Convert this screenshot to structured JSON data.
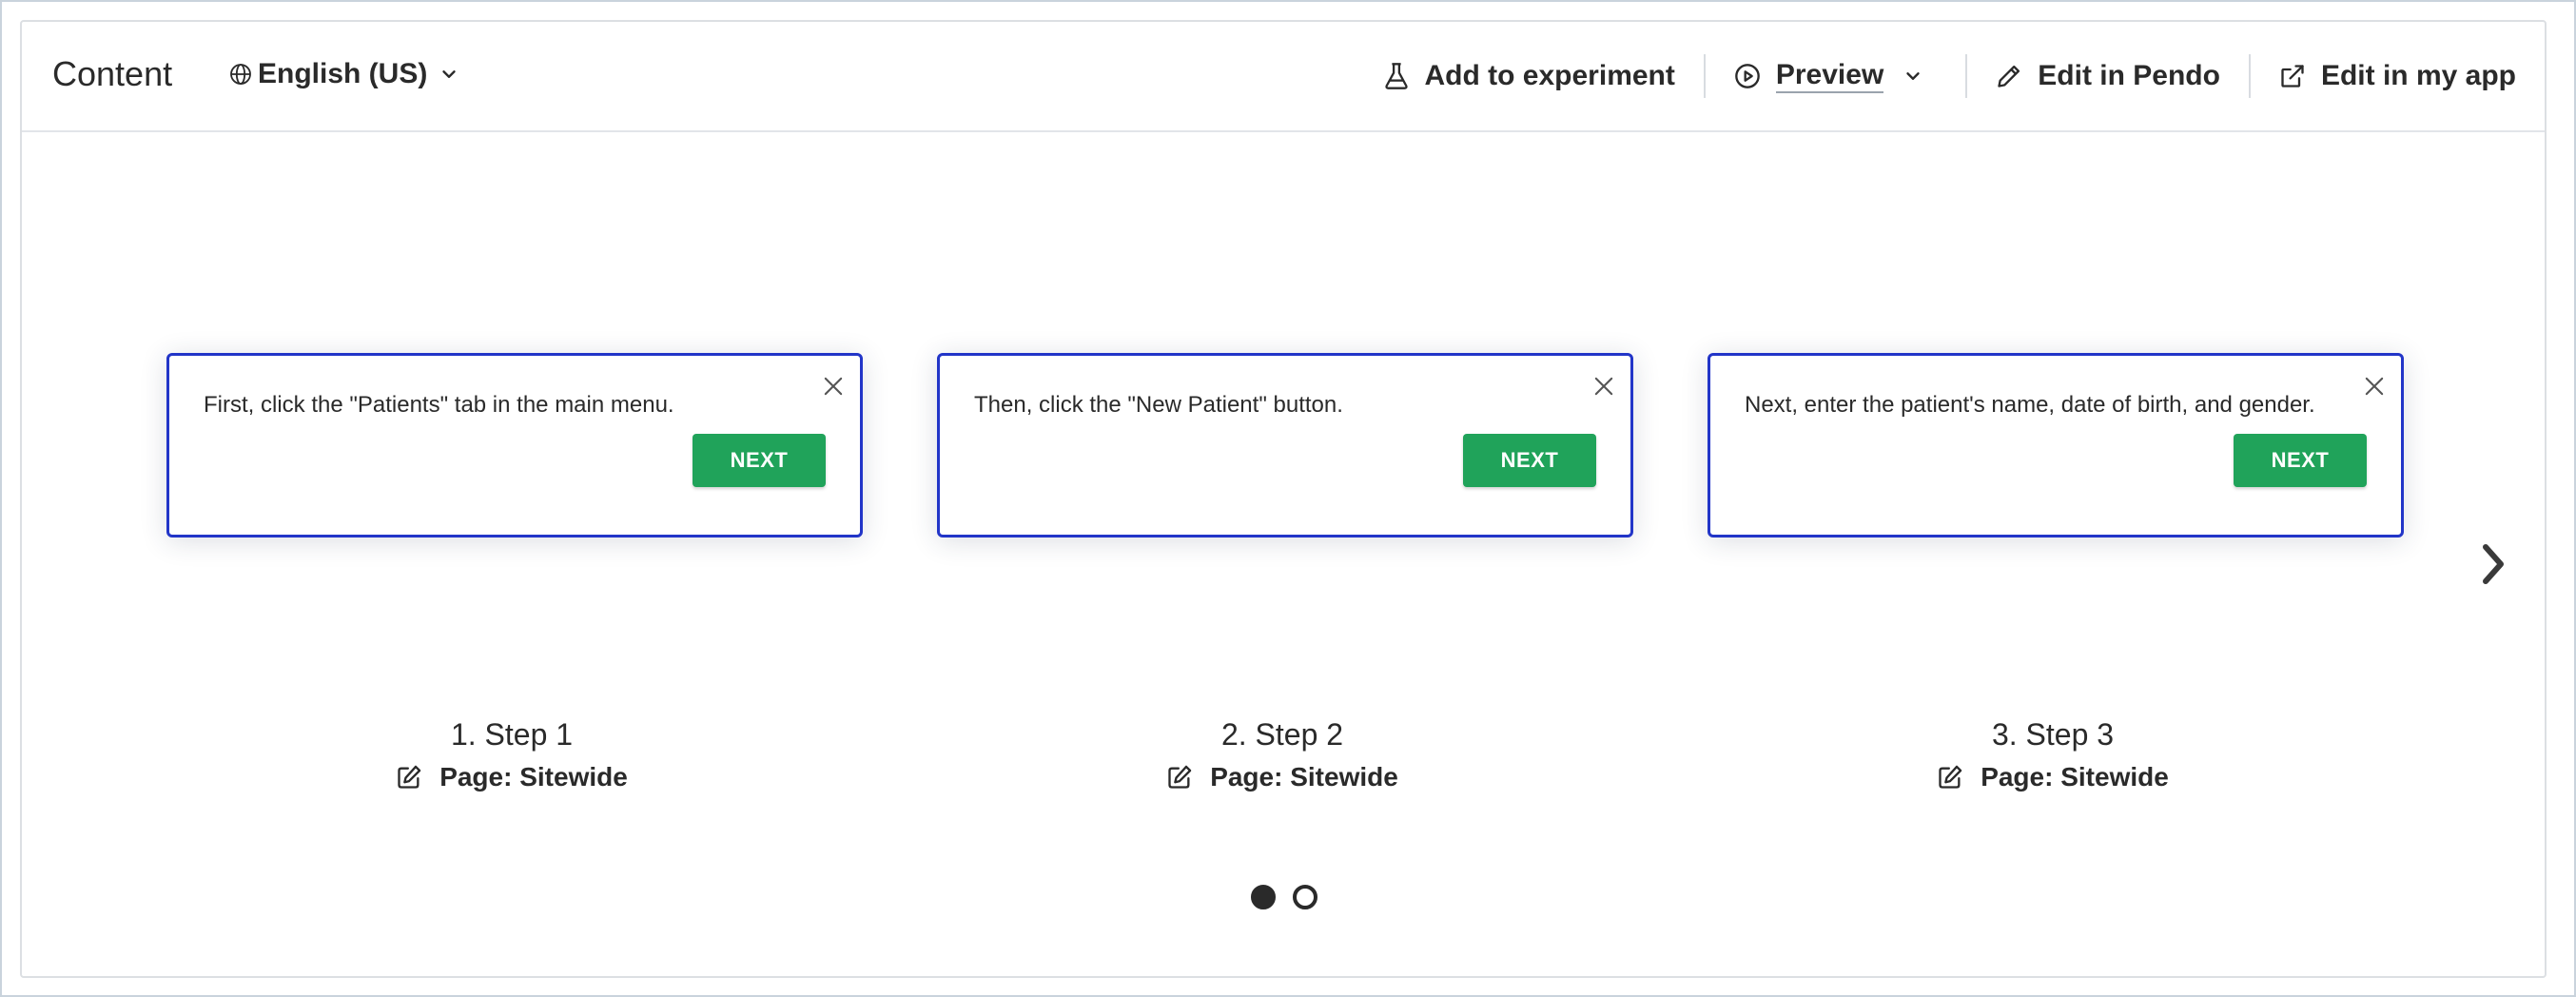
{
  "header": {
    "title": "Content",
    "language": {
      "label": "English (US)",
      "icon": "globe-icon"
    },
    "actions": {
      "experiment": {
        "label": "Add to experiment",
        "icon": "flask-icon"
      },
      "preview": {
        "label": "Preview",
        "icon": "play-circle-icon"
      },
      "edit_pendo": {
        "label": "Edit in Pendo",
        "icon": "pencil-icon"
      },
      "edit_app": {
        "label": "Edit in my app",
        "icon": "external-link-icon"
      }
    }
  },
  "steps": [
    {
      "text": "First, click the \"Patients\" tab in the main menu.",
      "button": "NEXT",
      "title": "1. Step 1",
      "page": "Page: Sitewide"
    },
    {
      "text": "Then, click the \"New Patient\" button.",
      "button": "NEXT",
      "title": "2. Step 2",
      "page": "Page: Sitewide"
    },
    {
      "text": "Next, enter the patient's name, date of birth, and gender.",
      "button": "NEXT",
      "title": "3. Step 3",
      "page": "Page: Sitewide"
    }
  ],
  "pagination": {
    "total_pages": 2,
    "current_page": 1
  },
  "colors": {
    "card_border": "#2235c8",
    "next_button": "#20a35a",
    "text": "#2a2a2a"
  }
}
